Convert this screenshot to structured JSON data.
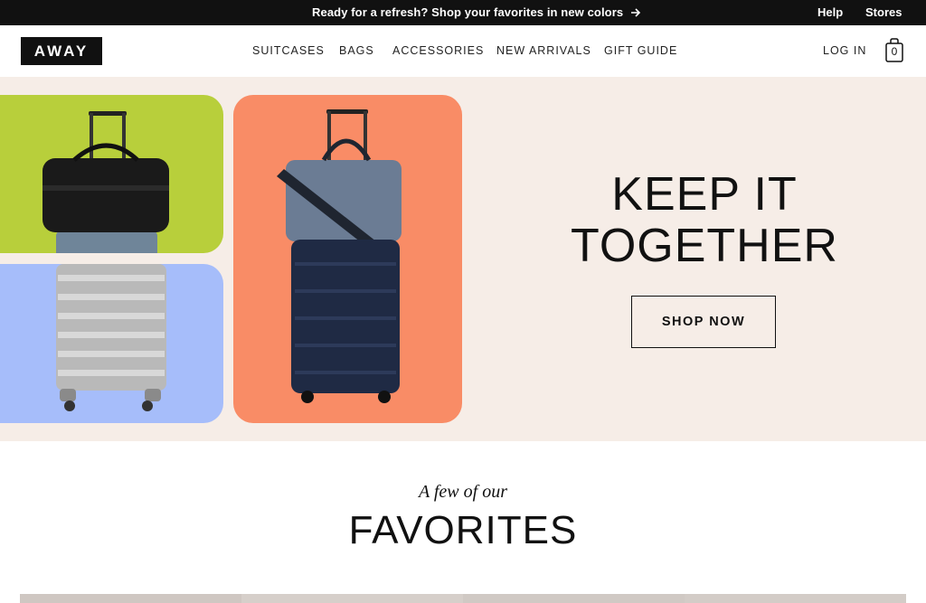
{
  "topbar": {
    "promo": "Ready for a refresh? Shop your favorites in new colors",
    "help": "Help",
    "stores": "Stores"
  },
  "header": {
    "logo": "AWAY",
    "nav": [
      "SUITCASES",
      "BAGS",
      "ACCESSORIES",
      "NEW ARRIVALS",
      "GIFT GUIDE"
    ],
    "login": "LOG IN",
    "cart_count": "0"
  },
  "hero": {
    "title_line1": "KEEP IT",
    "title_line2": "TOGETHER",
    "cta": "SHOP NOW",
    "tile_colors": {
      "green": "#b8cf3b",
      "blue": "#a6bdfa",
      "orange": "#f98c66"
    },
    "background": "#f6ede7"
  },
  "favorites": {
    "subtitle": "A few of our",
    "title": "FAVORITES"
  }
}
